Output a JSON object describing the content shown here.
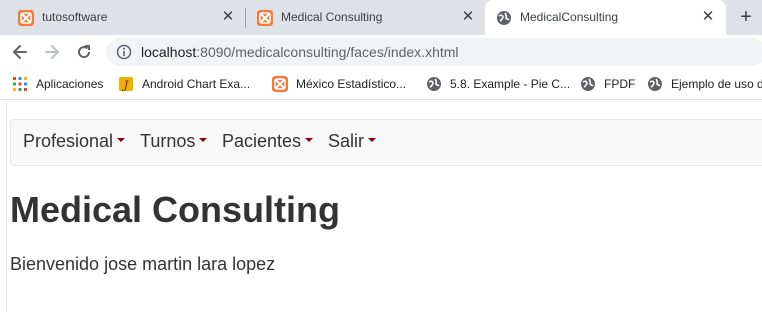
{
  "browser": {
    "tabs": [
      {
        "title": "tutosoftware",
        "favicon": "xampp-icon",
        "active": false
      },
      {
        "title": "Medical Consulting",
        "favicon": "xampp-icon",
        "active": false
      },
      {
        "title": "MedicalConsulting",
        "favicon": "globe-icon",
        "active": true
      }
    ],
    "new_tab_symbol": "+",
    "close_symbol": "✕",
    "address": {
      "host": "localhost",
      "rest": ":8090/medicalconsulting/faces/index.xhtml"
    },
    "bookmarks": [
      {
        "label": "Aplicaciones",
        "icon": "apps-grid-icon"
      },
      {
        "label": "Android Chart Exa...",
        "icon": "java-icon"
      },
      {
        "label": "México Estadístico...",
        "icon": "xampp-icon"
      },
      {
        "label": "5.8. Example - Pie C...",
        "icon": "globe-icon"
      },
      {
        "label": "FPDF",
        "icon": "globe-icon"
      },
      {
        "label": "Ejemplo de uso d",
        "icon": "globe-icon"
      }
    ]
  },
  "page": {
    "menu": [
      {
        "label": "Profesional"
      },
      {
        "label": "Turnos"
      },
      {
        "label": "Pacientes"
      },
      {
        "label": "Salir"
      }
    ],
    "heading": "Medical Consulting",
    "welcome": "Bienvenido jose martin lara lopez"
  },
  "colors": {
    "tabstrip": "#dee1e6",
    "omnibox": "#f1f3f4",
    "navbar_bg": "#f8f8f8",
    "caret": "#8b0000",
    "text": "#333333"
  }
}
